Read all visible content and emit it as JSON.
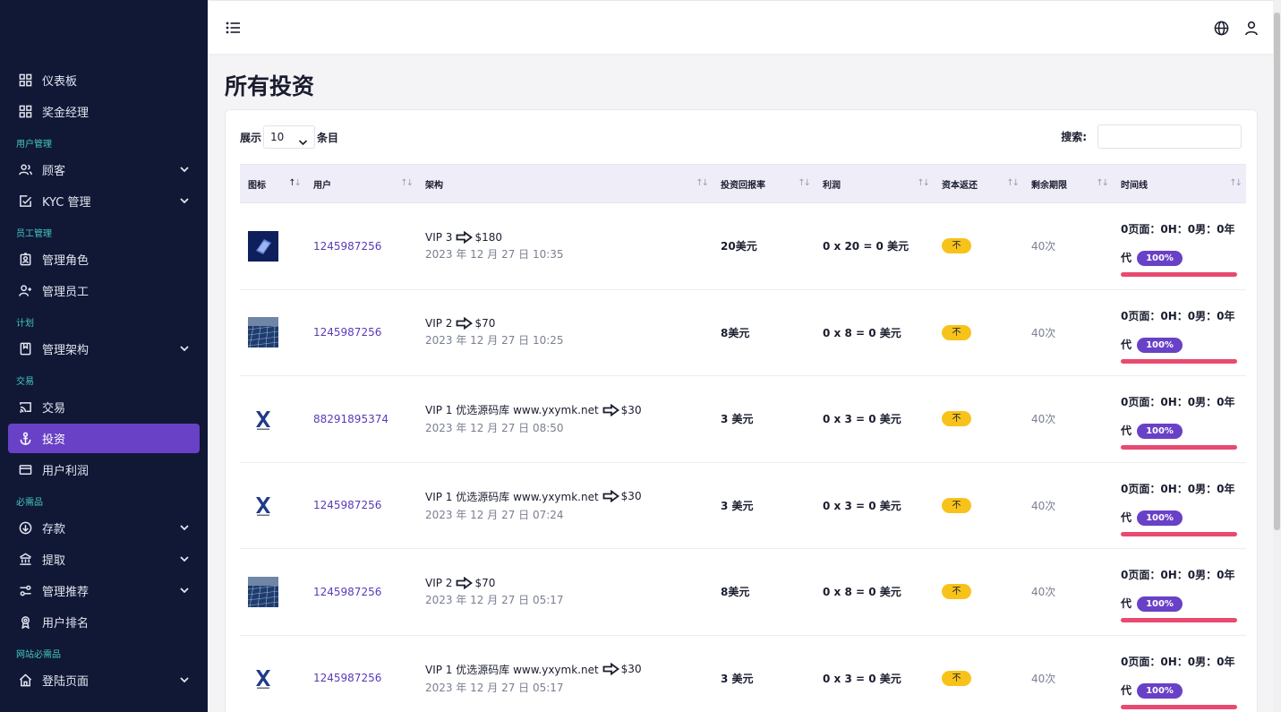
{
  "sidebar": {
    "items": [
      {
        "type": "item",
        "label": "仪表板",
        "icon": "grid-icon",
        "name": "sidebar-item-dashboard"
      },
      {
        "type": "item",
        "label": "奖金经理",
        "icon": "grid-icon",
        "name": "sidebar-item-bonus-manager"
      },
      {
        "type": "section",
        "label": "用户管理",
        "name": "section-user-management"
      },
      {
        "type": "item",
        "label": "顾客",
        "icon": "users-icon",
        "chevron": true,
        "name": "sidebar-item-customers"
      },
      {
        "type": "item",
        "label": "KYC 管理",
        "icon": "check-square-icon",
        "chevron": true,
        "name": "sidebar-item-kyc"
      },
      {
        "type": "section",
        "label": "员工管理",
        "name": "section-staff-management"
      },
      {
        "type": "item",
        "label": "管理角色",
        "icon": "badge-icon",
        "name": "sidebar-item-manage-roles"
      },
      {
        "type": "item",
        "label": "管理员工",
        "icon": "user-plus-icon",
        "name": "sidebar-item-manage-staff"
      },
      {
        "type": "section",
        "label": "计划",
        "name": "section-plan"
      },
      {
        "type": "item",
        "label": "管理架构",
        "icon": "bookmark-icon",
        "chevron": true,
        "name": "sidebar-item-manage-schema"
      },
      {
        "type": "section",
        "label": "交易",
        "name": "section-transactions"
      },
      {
        "type": "item",
        "label": "交易",
        "icon": "cast-icon",
        "name": "sidebar-item-transactions"
      },
      {
        "type": "item",
        "label": "投资",
        "icon": "anchor-icon",
        "active": true,
        "name": "sidebar-item-investments"
      },
      {
        "type": "item",
        "label": "用户利润",
        "icon": "credit-card-icon",
        "name": "sidebar-item-user-profit"
      },
      {
        "type": "section",
        "label": "必需品",
        "name": "section-essentials"
      },
      {
        "type": "item",
        "label": "存款",
        "icon": "arrow-down-circle-icon",
        "chevron": true,
        "name": "sidebar-item-deposit"
      },
      {
        "type": "item",
        "label": "提取",
        "icon": "bank-icon",
        "chevron": true,
        "name": "sidebar-item-withdraw"
      },
      {
        "type": "item",
        "label": "管理推荐",
        "icon": "sliders-icon",
        "chevron": true,
        "name": "sidebar-item-referrals"
      },
      {
        "type": "item",
        "label": "用户排名",
        "icon": "award-icon",
        "name": "sidebar-item-user-ranking"
      },
      {
        "type": "section",
        "label": "网站必需品",
        "name": "section-site-essentials"
      },
      {
        "type": "item",
        "label": "登陆页面",
        "icon": "home-icon",
        "chevron": true,
        "name": "sidebar-item-landing-page"
      }
    ]
  },
  "page": {
    "title": "所有投资"
  },
  "controls": {
    "show_label": "展示",
    "entries_value": "10",
    "entries_label": "条目",
    "search_label": "搜索:"
  },
  "table": {
    "headers": [
      {
        "label": "图标",
        "sort": "asc"
      },
      {
        "label": "用户"
      },
      {
        "label": "架构"
      },
      {
        "label": "投资回报率"
      },
      {
        "label": "利润"
      },
      {
        "label": "资本返还"
      },
      {
        "label": "剩余期限"
      },
      {
        "label": "时间线"
      }
    ],
    "rows": [
      {
        "image": "blue-card-image",
        "user": "1245987256",
        "plan": "VIP 3",
        "amount": "$180",
        "date": "2023 年 12 月 27 日 10:35",
        "roi": "20美元",
        "profit": "0 x 20 = 0 美元",
        "capital_back": "不",
        "remaining": "40次",
        "timeline": "0页面：0H：0男：0年代",
        "percent": "100%",
        "progress": 1.0
      },
      {
        "image": "solar-panel-image",
        "user": "1245987256",
        "plan": "VIP 2",
        "amount": "$70",
        "date": "2023 年 12 月 27 日 10:25",
        "roi": "8美元",
        "profit": "0 x 8 = 0 美元",
        "capital_back": "不",
        "remaining": "40次",
        "timeline": "0页面：0H：0男：0年代",
        "percent": "100%",
        "progress": 1.0
      },
      {
        "image": "logo-image",
        "user": "88291895374",
        "plan": "VIP 1 优选源码库 www.yxymk.net",
        "amount": "$30",
        "date": "2023 年 12 月 27 日 08:50",
        "roi": "3 美元",
        "profit": "0 x 3 = 0 美元",
        "capital_back": "不",
        "remaining": "40次",
        "timeline": "0页面：0H：0男：0年代",
        "percent": "100%",
        "progress": 1.0
      },
      {
        "image": "logo-image",
        "user": "1245987256",
        "plan": "VIP 1 优选源码库 www.yxymk.net",
        "amount": "$30",
        "date": "2023 年 12 月 27 日 07:24",
        "roi": "3 美元",
        "profit": "0 x 3 = 0 美元",
        "capital_back": "不",
        "remaining": "40次",
        "timeline": "0页面：0H：0男：0年代",
        "percent": "100%",
        "progress": 1.0
      },
      {
        "image": "solar-panel-image",
        "user": "1245987256",
        "plan": "VIP 2",
        "amount": "$70",
        "date": "2023 年 12 月 27 日 05:17",
        "roi": "8美元",
        "profit": "0 x 8 = 0 美元",
        "capital_back": "不",
        "remaining": "40次",
        "timeline": "0页面：0H：0男：0年代",
        "percent": "100%",
        "progress": 1.0
      },
      {
        "image": "logo-image",
        "user": "1245987256",
        "plan": "VIP 1 优选源码库 www.yxymk.net",
        "amount": "$30",
        "date": "2023 年 12 月 27 日 05:17",
        "roi": "3 美元",
        "profit": "0 x 3 = 0 美元",
        "capital_back": "不",
        "remaining": "40次",
        "timeline": "0页面：0H：0男：0年代",
        "percent": "100%",
        "progress": 1.0
      }
    ]
  },
  "colors": {
    "sidebar_bg": "#101836",
    "accent": "#6941c6",
    "section_label": "#45c7c0",
    "badge_yellow": "#f7c31a",
    "progress_pink": "#e84a70"
  }
}
